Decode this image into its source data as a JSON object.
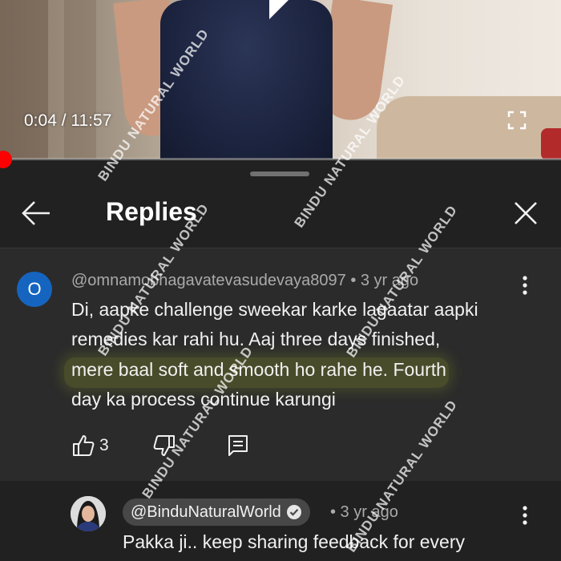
{
  "video": {
    "time_current": "0:04",
    "time_total": "11:57",
    "time_display": "0:04 / 11:57",
    "progress_fraction": 0.006,
    "progress_color": "#ff0000"
  },
  "panel": {
    "title": "Replies",
    "back_icon": "arrow-left-icon",
    "close_icon": "close-icon"
  },
  "parent_comment": {
    "avatar_letter": "O",
    "avatar_color": "#1565c0",
    "author": "@omnamobhagavatevasudevaya8097",
    "time": "3 yr ago",
    "meta": "@omnamobhagavatevasudevaya8097 • 3 yr ago",
    "lines": [
      "Di,  aapke challenge sweekar karke lagaatar aapki",
      "remedies kar rahi hu.  Aaj three days finished,",
      "mere baal soft and smooth ho rahe he.  Fourth",
      "day ka process continue karungi"
    ],
    "like_count": "3",
    "highlight_color": "#bed228"
  },
  "reply": {
    "author": "@BinduNaturalWorld",
    "verified_icon": "verified-check-icon",
    "time": "• 3 yr ago",
    "text": "Pakka ji.. keep sharing feedback for every"
  },
  "watermark": {
    "text": "BINDU NATURAL WORLD"
  }
}
